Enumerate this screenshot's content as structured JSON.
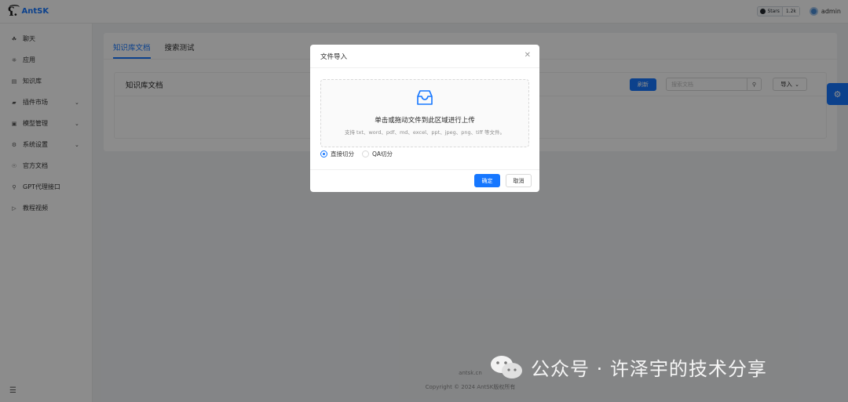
{
  "app": {
    "logo_mark": "ʕ͡.",
    "logo_text": "AntSK"
  },
  "header": {
    "github_star_label": "Stars",
    "github_star_count": "1.2k",
    "username": "admin"
  },
  "sidebar": {
    "items": [
      {
        "label": "聊天",
        "icon": "chat-icon",
        "expandable": false
      },
      {
        "label": "应用",
        "icon": "apps-icon",
        "expandable": false
      },
      {
        "label": "知识库",
        "icon": "book-icon",
        "expandable": false
      },
      {
        "label": "插件市场",
        "icon": "plugin-icon",
        "expandable": true
      },
      {
        "label": "模型管理",
        "icon": "model-icon",
        "expandable": true
      },
      {
        "label": "系统设置",
        "icon": "settings-icon",
        "expandable": true
      },
      {
        "label": "官方文档",
        "icon": "doc-icon",
        "expandable": false
      },
      {
        "label": "GPT代理接口",
        "icon": "api-icon",
        "expandable": false
      },
      {
        "label": "教程视频",
        "icon": "video-icon",
        "expandable": false
      }
    ]
  },
  "main": {
    "tabs": [
      "知识库文档",
      "搜索测试"
    ],
    "active_tab": 0,
    "section_title": "知识库文档",
    "refresh_label": "刷新",
    "search_placeholder": "搜索文档",
    "import_label": "导入"
  },
  "footer": {
    "link": "antsk.cn",
    "copyright": "Copyright © 2024 AntSK版权所有"
  },
  "modal": {
    "title": "文件导入",
    "drop_text": "单击或拖动文件到此区域进行上传",
    "drop_hint": "支持 txt、word、pdf、md、excel、ppt、jpeg、png、tiff 等文件。",
    "radio_direct": "直接切分",
    "radio_qa": "QA切分",
    "selected": "direct",
    "ok_label": "确定",
    "cancel_label": "取消"
  },
  "watermark": {
    "text": "公众号 · 许泽宇的技术分享"
  },
  "colors": {
    "primary": "#1677ff",
    "mask": "rgba(0,0,0,0.45)"
  }
}
